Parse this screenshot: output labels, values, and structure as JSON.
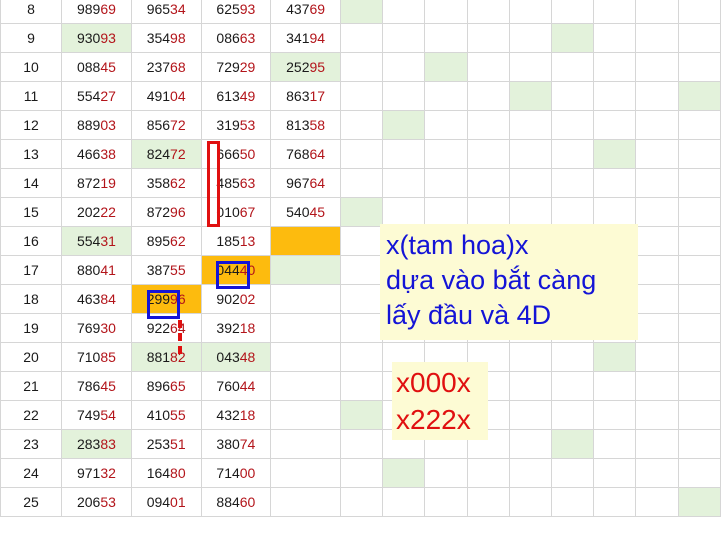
{
  "rows": [
    {
      "idx": "8",
      "n": [
        [
          "989",
          "69"
        ],
        [
          "965",
          "34"
        ],
        [
          "625",
          "93"
        ],
        [
          "437",
          "69"
        ]
      ],
      "g": [
        0,
        0,
        0,
        0
      ],
      "o": [
        0,
        0,
        0,
        0
      ],
      "m": [
        1,
        0,
        0,
        0,
        0,
        0,
        0,
        0,
        0
      ]
    },
    {
      "idx": "9",
      "n": [
        [
          "930",
          "93"
        ],
        [
          "354",
          "98"
        ],
        [
          "086",
          "63"
        ],
        [
          "341",
          "94"
        ]
      ],
      "g": [
        1,
        0,
        0,
        0
      ],
      "o": [
        0,
        0,
        0,
        0
      ],
      "m": [
        0,
        0,
        0,
        0,
        0,
        1,
        0,
        0,
        0
      ]
    },
    {
      "idx": "10",
      "n": [
        [
          "088",
          "45"
        ],
        [
          "237",
          "68"
        ],
        [
          "729",
          "29"
        ],
        [
          "252",
          "95"
        ]
      ],
      "g": [
        0,
        0,
        0,
        1
      ],
      "o": [
        0,
        0,
        0,
        0
      ],
      "m": [
        0,
        0,
        1,
        0,
        0,
        0,
        0,
        0,
        0
      ]
    },
    {
      "idx": "11",
      "n": [
        [
          "554",
          "27"
        ],
        [
          "491",
          "04"
        ],
        [
          "613",
          "49"
        ],
        [
          "863",
          "17"
        ]
      ],
      "g": [
        0,
        0,
        0,
        0
      ],
      "o": [
        0,
        0,
        0,
        0
      ],
      "m": [
        0,
        0,
        0,
        0,
        1,
        0,
        0,
        0,
        1
      ]
    },
    {
      "idx": "12",
      "n": [
        [
          "889",
          "03"
        ],
        [
          "856",
          "72"
        ],
        [
          "319",
          "53"
        ],
        [
          "813",
          "58"
        ]
      ],
      "g": [
        0,
        0,
        0,
        0
      ],
      "o": [
        0,
        0,
        0,
        0
      ],
      "m": [
        0,
        1,
        0,
        0,
        0,
        0,
        0,
        0,
        0
      ]
    },
    {
      "idx": "13",
      "n": [
        [
          "466",
          "38"
        ],
        [
          "824",
          "72"
        ],
        [
          "666",
          "50"
        ],
        [
          "768",
          "64"
        ]
      ],
      "g": [
        0,
        1,
        0,
        0
      ],
      "o": [
        0,
        0,
        0,
        0
      ],
      "m": [
        0,
        0,
        0,
        0,
        0,
        0,
        1,
        0,
        0
      ]
    },
    {
      "idx": "14",
      "n": [
        [
          "872",
          "19"
        ],
        [
          "358",
          "62"
        ],
        [
          "485",
          "63"
        ],
        [
          "967",
          "64"
        ]
      ],
      "g": [
        0,
        0,
        0,
        0
      ],
      "o": [
        0,
        0,
        0,
        0
      ],
      "m": [
        0,
        0,
        0,
        0,
        0,
        0,
        0,
        0,
        0
      ]
    },
    {
      "idx": "15",
      "n": [
        [
          "202",
          "22"
        ],
        [
          "872",
          "96"
        ],
        [
          "010",
          "67"
        ],
        [
          "540",
          "45"
        ]
      ],
      "g": [
        0,
        0,
        0,
        0
      ],
      "o": [
        0,
        0,
        0,
        0
      ],
      "m": [
        1,
        0,
        0,
        0,
        0,
        0,
        0,
        0,
        0
      ]
    },
    {
      "idx": "16",
      "n": [
        [
          "554",
          "31"
        ],
        [
          "895",
          "62"
        ],
        [
          "185",
          "13"
        ],
        [
          "",
          ""
        ]
      ],
      "g": [
        1,
        0,
        0,
        0
      ],
      "o": [
        0,
        0,
        0,
        1
      ],
      "m": [
        0,
        0,
        0,
        0,
        0,
        0,
        0,
        0,
        0
      ]
    },
    {
      "idx": "17",
      "n": [
        [
          "880",
          "41"
        ],
        [
          "387",
          "55"
        ],
        [
          "044",
          "40"
        ],
        [
          "",
          ""
        ]
      ],
      "g": [
        0,
        0,
        0,
        1
      ],
      "o": [
        0,
        0,
        1,
        0
      ],
      "m": [
        0,
        0,
        0,
        0,
        0,
        0,
        0,
        0,
        0
      ]
    },
    {
      "idx": "18",
      "n": [
        [
          "463",
          "84"
        ],
        [
          "299",
          "96"
        ],
        [
          "902",
          "02"
        ],
        [
          "",
          ""
        ]
      ],
      "g": [
        0,
        0,
        0,
        0
      ],
      "o": [
        0,
        1,
        0,
        0
      ],
      "m": [
        0,
        0,
        0,
        0,
        0,
        0,
        0,
        0,
        0
      ]
    },
    {
      "idx": "19",
      "n": [
        [
          "769",
          "30"
        ],
        [
          "922",
          "64"
        ],
        [
          "392",
          "18"
        ],
        [
          "",
          ""
        ]
      ],
      "g": [
        0,
        0,
        0,
        0
      ],
      "o": [
        0,
        0,
        0,
        0
      ],
      "m": [
        0,
        0,
        0,
        0,
        0,
        0,
        0,
        0,
        0
      ]
    },
    {
      "idx": "20",
      "n": [
        [
          "710",
          "85"
        ],
        [
          "881",
          "82"
        ],
        [
          "043",
          "48"
        ],
        [
          "",
          ""
        ]
      ],
      "g": [
        0,
        1,
        1,
        0
      ],
      "o": [
        0,
        0,
        0,
        0
      ],
      "m": [
        0,
        0,
        0,
        0,
        0,
        0,
        1,
        0,
        0
      ]
    },
    {
      "idx": "21",
      "n": [
        [
          "786",
          "45"
        ],
        [
          "896",
          "65"
        ],
        [
          "760",
          "44"
        ],
        [
          "",
          ""
        ]
      ],
      "g": [
        0,
        0,
        0,
        0
      ],
      "o": [
        0,
        0,
        0,
        0
      ],
      "m": [
        0,
        0,
        0,
        0,
        0,
        0,
        0,
        0,
        0
      ]
    },
    {
      "idx": "22",
      "n": [
        [
          "749",
          "54"
        ],
        [
          "410",
          "55"
        ],
        [
          "432",
          "18"
        ],
        [
          "",
          ""
        ]
      ],
      "g": [
        0,
        0,
        0,
        0
      ],
      "o": [
        0,
        0,
        0,
        0
      ],
      "m": [
        1,
        0,
        0,
        0,
        0,
        0,
        0,
        0,
        0
      ]
    },
    {
      "idx": "23",
      "n": [
        [
          "283",
          "83"
        ],
        [
          "253",
          "51"
        ],
        [
          "380",
          "74"
        ],
        [
          "",
          ""
        ]
      ],
      "g": [
        1,
        0,
        0,
        0
      ],
      "o": [
        0,
        0,
        0,
        0
      ],
      "m": [
        0,
        0,
        0,
        0,
        0,
        1,
        0,
        0,
        0
      ]
    },
    {
      "idx": "24",
      "n": [
        [
          "971",
          "32"
        ],
        [
          "164",
          "80"
        ],
        [
          "714",
          "00"
        ],
        [
          "",
          ""
        ]
      ],
      "g": [
        0,
        0,
        0,
        0
      ],
      "o": [
        0,
        0,
        0,
        0
      ],
      "m": [
        0,
        1,
        0,
        0,
        0,
        0,
        0,
        0,
        0
      ]
    },
    {
      "idx": "25",
      "n": [
        [
          "206",
          "53"
        ],
        [
          "094",
          "01"
        ],
        [
          "884",
          "60"
        ],
        [
          "",
          ""
        ]
      ],
      "g": [
        0,
        0,
        0,
        0
      ],
      "o": [
        0,
        0,
        0,
        0
      ],
      "m": [
        0,
        0,
        0,
        0,
        0,
        0,
        0,
        0,
        1
      ]
    }
  ],
  "note_blue": {
    "line1": "x(tam hoa)x",
    "line2": "dựa vào bắt càng",
    "line3": "lấy đầu và 4D",
    "color": "#1414d6"
  },
  "note_red": {
    "line1": "x000x",
    "line2": "x222x",
    "color": "#e01010"
  },
  "colors": {
    "row_index": "#1f3fb5",
    "last_two_digits": "#b3141a",
    "hit_cell": "#e3f2db",
    "highlight_cell": "#fdbb0e",
    "red_marker": "#e01010",
    "blue_marker": "#1414d6"
  }
}
